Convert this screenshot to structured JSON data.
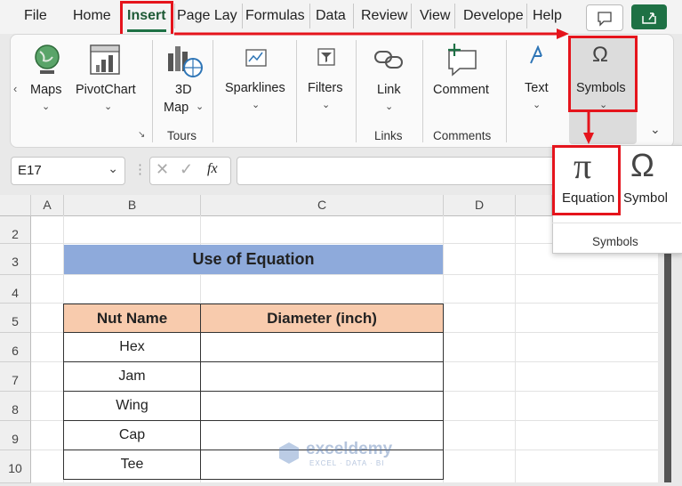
{
  "tabs": [
    "File",
    "Home",
    "Insert",
    "Page Lay",
    "Formulas",
    "Data",
    "Review",
    "View",
    "Develope",
    "Help"
  ],
  "ribbon": {
    "maps": "Maps",
    "pivotchart": "PivotChart",
    "map3d_line1": "3D",
    "map3d_line2": "Map",
    "sparklines": "Sparklines",
    "filters": "Filters",
    "link": "Link",
    "comment": "Comment",
    "text": "Text",
    "symbols": "Symbols",
    "groups": {
      "tours": "Tours",
      "links": "Links",
      "comments": "Comments"
    }
  },
  "symbols_dropdown": {
    "equation_glyph": "π",
    "equation_label": "Equation",
    "symbol_glyph": "Ω",
    "symbol_label": "Symbol",
    "group_label": "Symbols"
  },
  "formula_bar": {
    "name_box": "E17",
    "fx": "fx",
    "formula": ""
  },
  "columns": [
    "A",
    "B",
    "C",
    "D"
  ],
  "rows": [
    "2",
    "3",
    "4",
    "5",
    "6",
    "7",
    "8",
    "9",
    "10"
  ],
  "sheet": {
    "title": "Use of Equation",
    "header": [
      "Nut Name",
      "Diameter (inch)"
    ],
    "nut_names": [
      "Hex",
      "Jam",
      "Wing",
      "Cap",
      "Tee"
    ]
  },
  "watermark": {
    "brand": "exceldemy",
    "tagline": "EXCEL · DATA · BI"
  },
  "colors": {
    "accent_green": "#1e7145",
    "title_fill": "#8eaadb",
    "header_fill": "#f8cbad",
    "highlight_red": "#e5141c"
  }
}
